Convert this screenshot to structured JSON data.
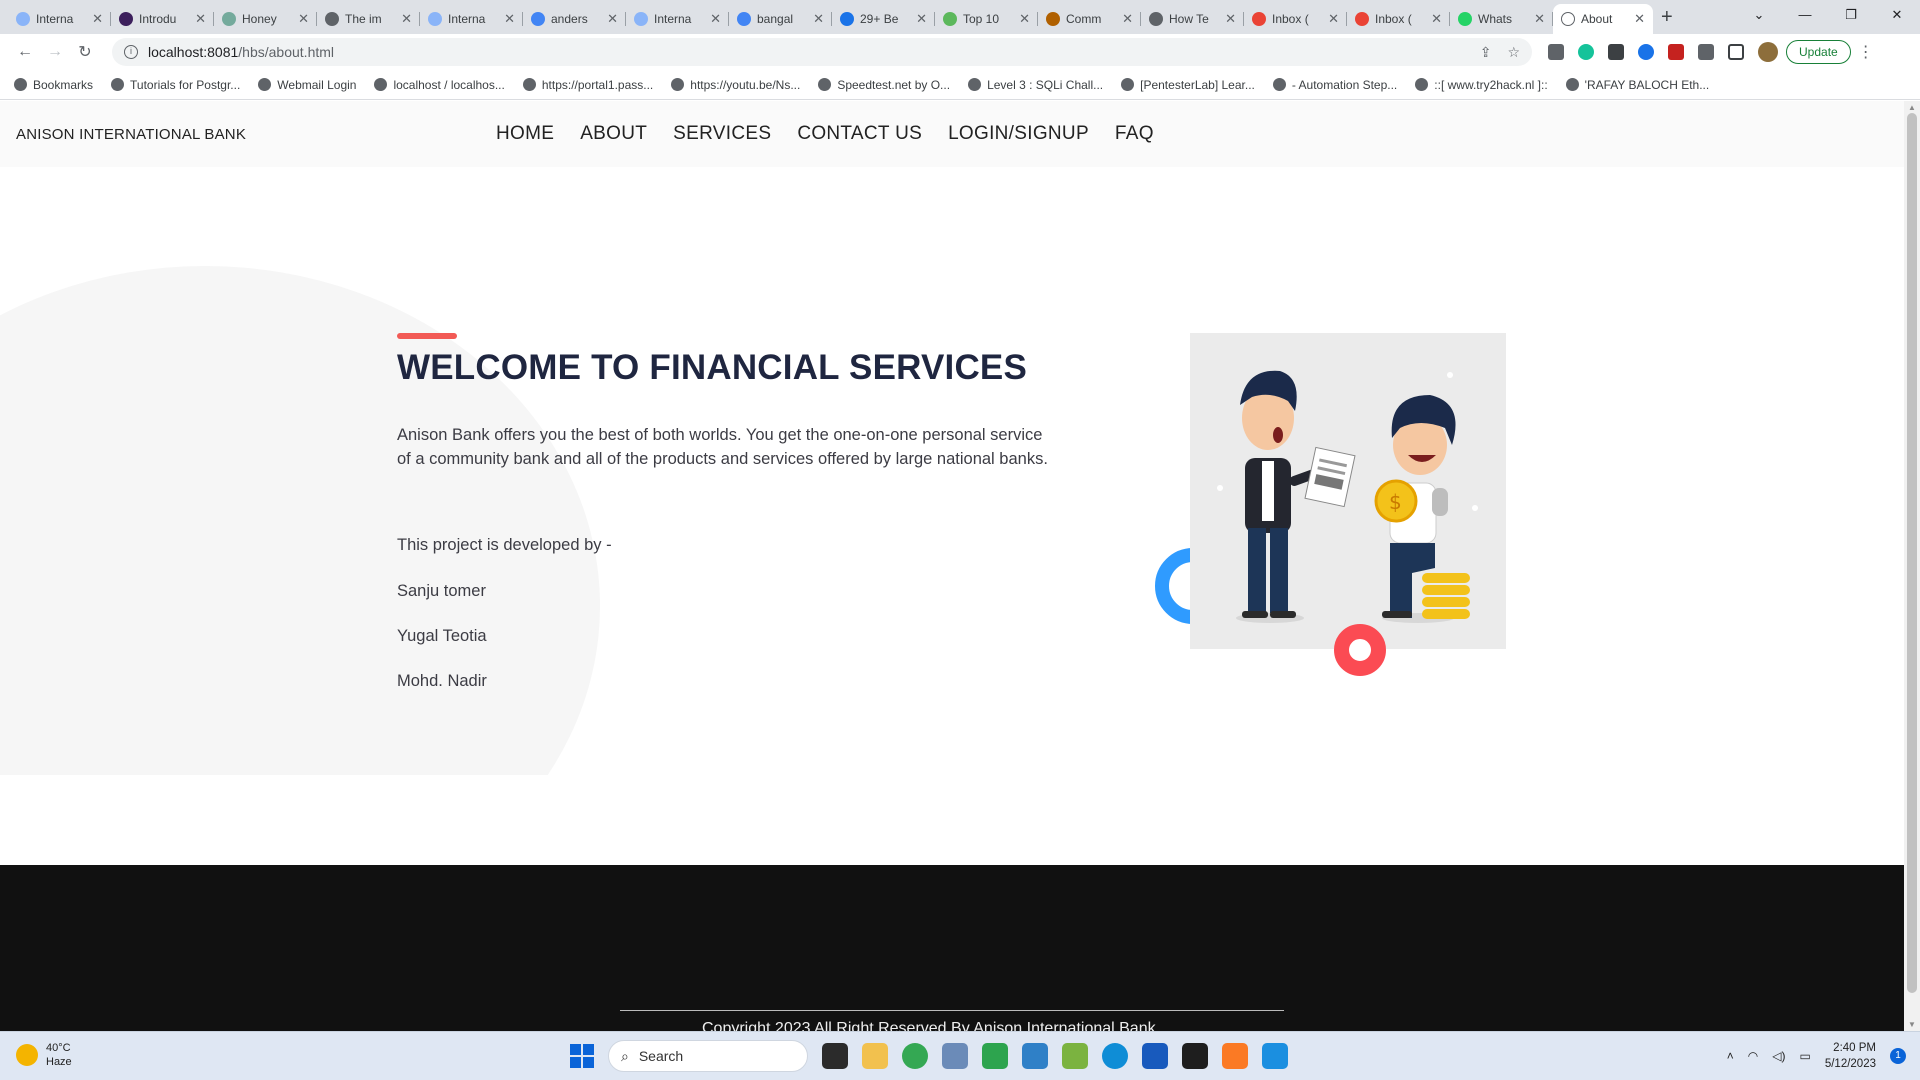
{
  "browser": {
    "tabs": [
      {
        "title": "Interna",
        "color": "#8ab4f8"
      },
      {
        "title": "Introdu",
        "color": "#3c1f5c"
      },
      {
        "title": "Honey",
        "color": "#74aa9c"
      },
      {
        "title": "The im",
        "color": "#5f6368"
      },
      {
        "title": "Interna",
        "color": "#8ab4f8"
      },
      {
        "title": "anders",
        "color": "#4285f4"
      },
      {
        "title": "Interna",
        "color": "#8ab4f8"
      },
      {
        "title": "bangal",
        "color": "#4285f4"
      },
      {
        "title": "29+ Be",
        "color": "#1a73e8"
      },
      {
        "title": "Top 10",
        "color": "#5cb85c"
      },
      {
        "title": "Comm",
        "color": "#b06000"
      },
      {
        "title": "How Te",
        "color": "#5f6368"
      },
      {
        "title": "Inbox (",
        "color": "#ea4335"
      },
      {
        "title": "Inbox (",
        "color": "#ea4335"
      },
      {
        "title": "Whats",
        "color": "#25d366"
      }
    ],
    "active_tab": {
      "title": "About",
      "color": "#5f6368"
    },
    "url_host": "localhost:8081",
    "url_path": "/hbs/about.html",
    "update_label": "Update",
    "bookmarks": [
      "Bookmarks",
      "Tutorials for Postgr...",
      "Webmail Login",
      "localhost / localhos...",
      "https://portal1.pass...",
      "https://youtu.be/Ns...",
      "Speedtest.net by O...",
      "Level 3 : SQLi Chall...",
      "[PentesterLab] Lear...",
      "- Automation Step...",
      "::[ www.try2hack.nl ]::",
      "'RAFAY BALOCH Eth..."
    ]
  },
  "site": {
    "brand": "ANISON INTERNATIONAL BANK",
    "nav": [
      "HOME",
      "ABOUT",
      "SERVICES",
      "CONTACT US",
      "LOGIN/SIGNUP",
      "FAQ"
    ],
    "heading": "WELCOME TO FINANCIAL SERVICES",
    "about_text": "Anison Bank offers you the best of both worlds. You get the one-on-one personal service of a community bank and all of the products and services offered by large national banks.",
    "dev_intro": "This project is developed by -",
    "developers": [
      "Sanju tomer",
      "Yugal Teotia",
      "Mohd. Nadir"
    ],
    "copyright": "Copyright 2023 All Right Reserved By Anison International Bank"
  },
  "taskbar": {
    "temperature": "40°C",
    "weather": "Haze",
    "search_placeholder": "Search",
    "time": "2:40 PM",
    "date": "5/12/2023",
    "notifications": "1"
  }
}
